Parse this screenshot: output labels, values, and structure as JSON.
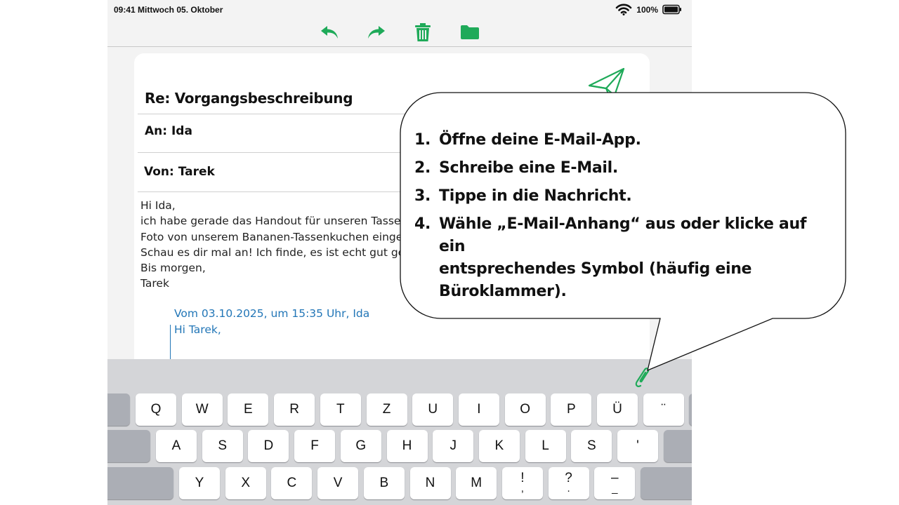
{
  "status_bar": {
    "time_date": "09:41 Mittwoch 05. Oktober",
    "battery": "100%"
  },
  "toolbar": {
    "icons": [
      "reply-icon",
      "forward-icon",
      "trash-icon",
      "folder-icon"
    ],
    "accent_color": "#1faa59"
  },
  "mail": {
    "subject": "Re: Vorgangsbeschreibung",
    "to": "An: Ida",
    "from": "Von: Tarek",
    "body_lines": [
      "Hi Ida,",
      "ich habe gerade das Handout für unseren Tassen",
      "Foto von unserem Bananen-Tassenkuchen eingef",
      "Schau es dir mal an! Ich finde, es ist echt gut gew",
      "Bis morgen,",
      "Tarek"
    ],
    "quote_header": "Vom 03.10.2025, um 15:35 Uhr, Ida",
    "quote_greeting": "Hi Tarek,",
    "quote_color": "#2276b7"
  },
  "keyboard": {
    "row1": [
      "Q",
      "W",
      "E",
      "R",
      "T",
      "Z",
      "U",
      "I",
      "O",
      "P",
      "Ü",
      "¨"
    ],
    "row2": [
      "A",
      "S",
      "D",
      "F",
      "G",
      "H",
      "J",
      "K",
      "L",
      "S",
      "'"
    ],
    "row3": [
      "Y",
      "X",
      "C",
      "V",
      "B",
      "N",
      "M",
      "!",
      "?",
      "–"
    ],
    "row3_sub": [
      "",
      "",
      "",
      "",
      "",
      "",
      "",
      ",",
      ".",
      "_"
    ]
  },
  "instructions": {
    "steps": [
      {
        "num": "1.",
        "text": "Öffne deine E-Mail-App."
      },
      {
        "num": "2.",
        "text": "Schreibe eine E-Mail."
      },
      {
        "num": "3.",
        "text": "Tippe in die Nachricht."
      },
      {
        "num": "4.",
        "text": "Wähle „E-Mail-Anhang“ aus oder klicke auf ein\nentsprechendes Symbol (häufig eine\nBüroklammer)."
      }
    ]
  }
}
